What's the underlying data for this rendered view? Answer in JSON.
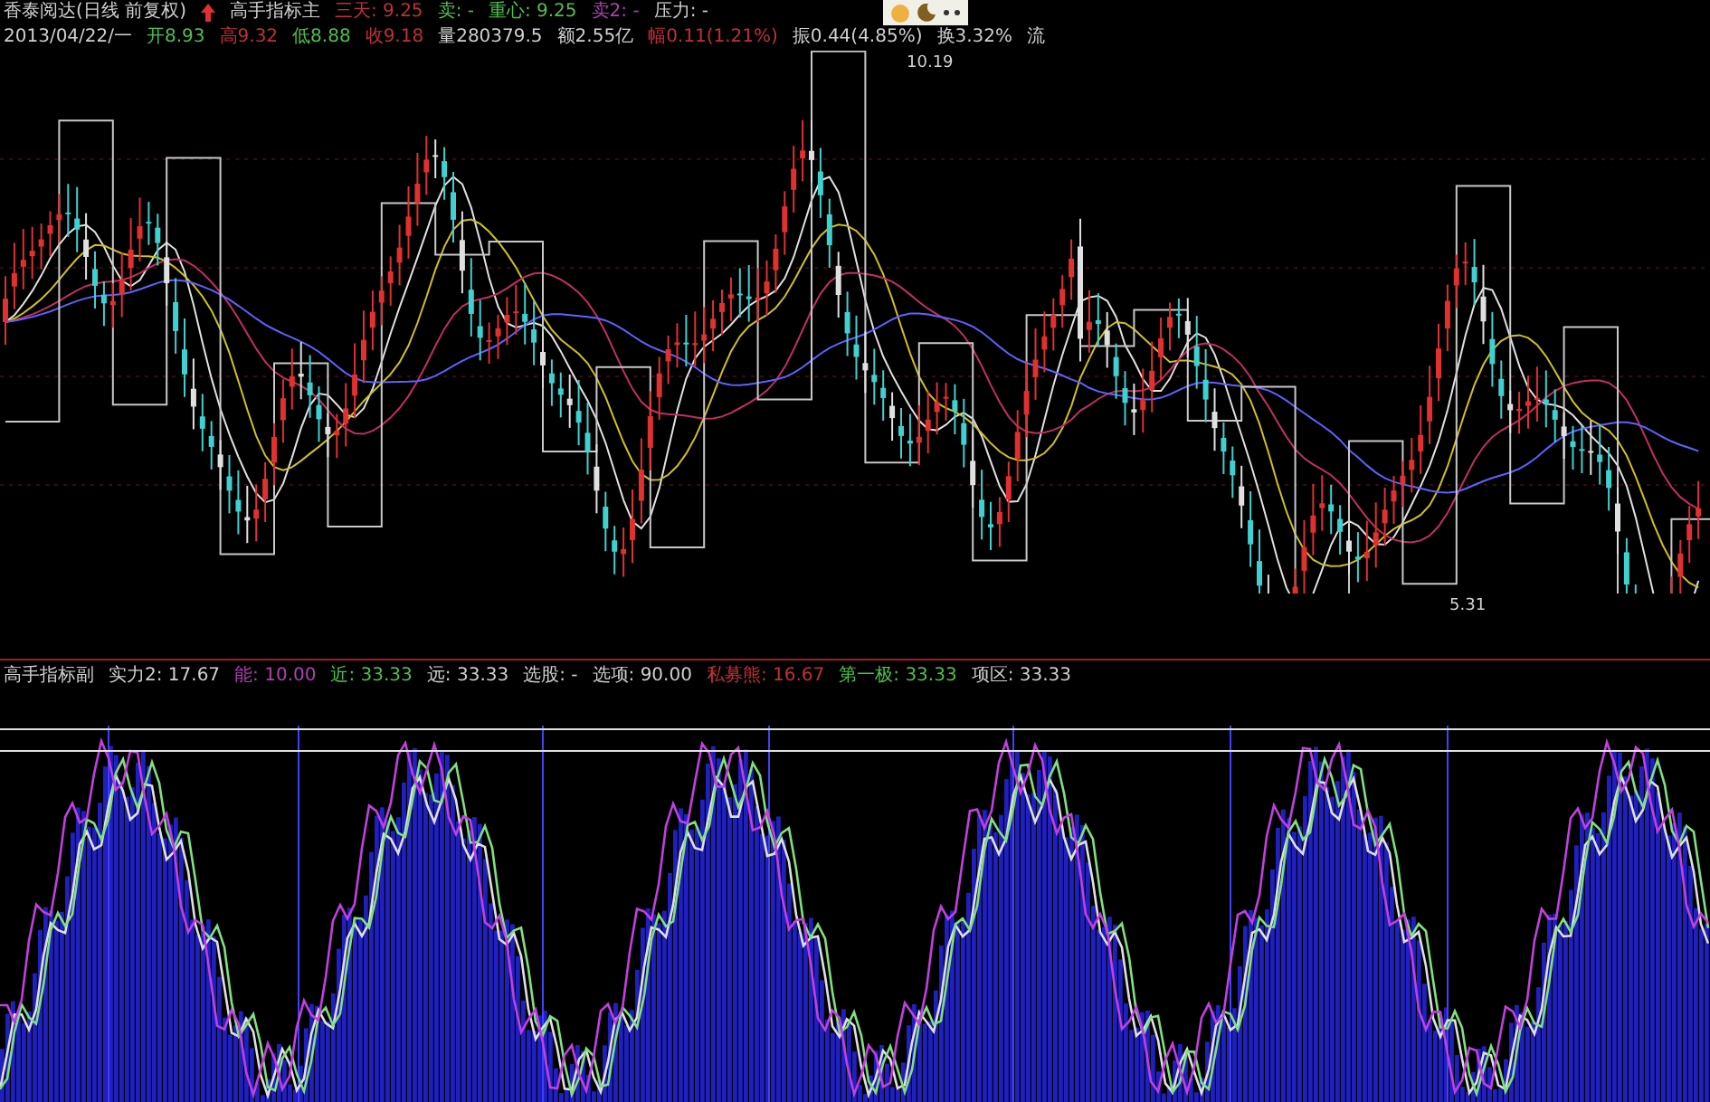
{
  "main_panel": {
    "title": "香泰阅达(日线 前复权)",
    "indicator": "高手指标主",
    "values": [
      {
        "text": "三天: 9.25",
        "color": "#c0303a"
      },
      {
        "text": "卖: -",
        "color": "#50c050"
      },
      {
        "text": "重心: 9.25",
        "color": "#50c050"
      },
      {
        "text": "卖2: -",
        "color": "#b040b0"
      },
      {
        "text": "压力: -",
        "color": "#d0d0d0"
      }
    ],
    "quote": [
      {
        "text": "2013/04/22/一",
        "color": "#d0d0d0"
      },
      {
        "text": "开8.93",
        "color": "#50c050"
      },
      {
        "text": "高9.32",
        "color": "#c0303a"
      },
      {
        "text": "低8.88",
        "color": "#50c050"
      },
      {
        "text": "收9.18",
        "color": "#c0303a"
      },
      {
        "text": "量280379.5",
        "color": "#d0d0d0"
      },
      {
        "text": "额2.55亿",
        "color": "#d0d0d0"
      },
      {
        "text": "幅0.11(1.21%)",
        "color": "#c0303a"
      },
      {
        "text": "振0.44(4.85%)",
        "color": "#d0d0d0"
      },
      {
        "text": "换3.32%",
        "color": "#d0d0d0"
      },
      {
        "text": "流",
        "color": "#d0d0d0"
      }
    ],
    "price_labels": [
      {
        "text": "10.19"
      },
      {
        "text": "5.31"
      }
    ]
  },
  "sub_panel": {
    "indicator": "高手指标副",
    "values": [
      {
        "text": "实力2: 17.67",
        "color": "#d0d0d0"
      },
      {
        "text": "能: 10.00",
        "color": "#b040b0"
      },
      {
        "text": "近: 33.33",
        "color": "#50c050"
      },
      {
        "text": "远: 33.33",
        "color": "#d0d0d0"
      },
      {
        "text": "选股: -",
        "color": "#d0d0d0"
      },
      {
        "text": "选项: 90.00",
        "color": "#d0d0d0"
      },
      {
        "text": "私募熊: 16.67",
        "color": "#c0303a"
      },
      {
        "text": "第一极: 33.33",
        "color": "#50c050"
      },
      {
        "text": "项区: 33.33",
        "color": "#d0d0d0"
      }
    ]
  }
}
